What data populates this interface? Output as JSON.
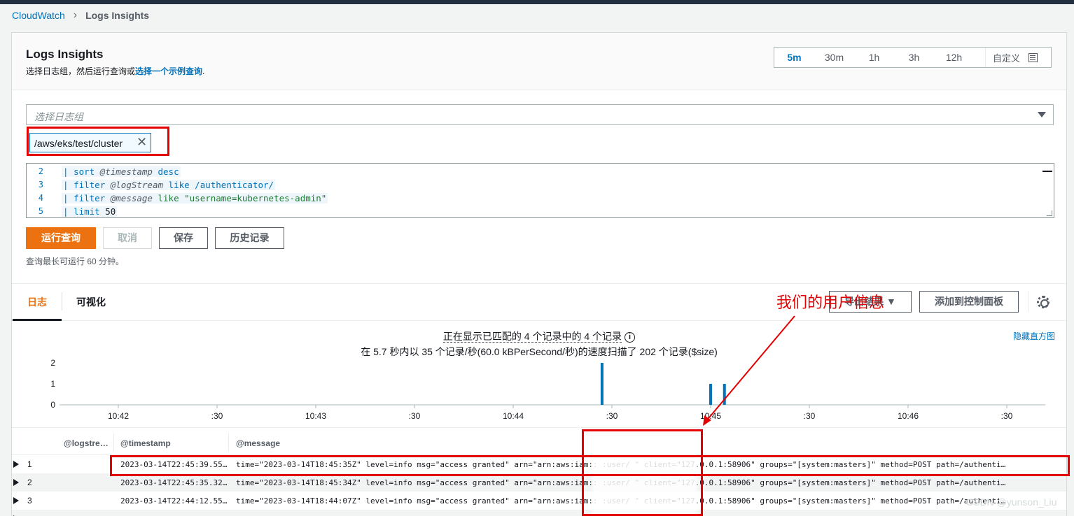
{
  "breadcrumb": {
    "root": "CloudWatch",
    "current": "Logs Insights"
  },
  "header": {
    "title": "Logs Insights",
    "subtitle_prefix": "选择日志组，然后运行查询或",
    "subtitle_link": "选择一个示例查询",
    "subtitle_suffix": "."
  },
  "time_range": {
    "options": [
      "5m",
      "30m",
      "1h",
      "3h",
      "12h"
    ],
    "selected": "5m",
    "custom_label": "自定义"
  },
  "log_group_select": {
    "placeholder": "选择日志组",
    "selected_token": "/aws/eks/test/cluster"
  },
  "query": {
    "lines": [
      {
        "n": "2",
        "kw": "sort",
        "field": "@timestamp",
        "rest": "desc"
      },
      {
        "n": "3",
        "kw": "filter",
        "field": "@logStream",
        "rest": "like /authenticator/"
      },
      {
        "n": "4",
        "kw": "filter",
        "field": "@message",
        "rest": "like \"username=kubernetes-admin\""
      },
      {
        "n": "5",
        "kw": "limit",
        "field": "",
        "rest": "50"
      }
    ]
  },
  "actions": {
    "run": "运行查询",
    "cancel": "取消",
    "save": "保存",
    "history": "历史记录"
  },
  "note": "查询最长可运行 60 分钟。",
  "tabs": {
    "logs": "日志",
    "visualization": "可视化",
    "export": "导出结果",
    "add_dashboard": "添加到控制面板"
  },
  "stats": {
    "line1": "正在显示已匹配的 4 个记录中的 4 个记录",
    "line2": "在 5.7 秒内以 35 个记录/秒(60.0 kBPerSecond/秒)的速度扫描了 202 个记录($size)",
    "hide_histogram": "隐藏直方图"
  },
  "chart_data": {
    "type": "bar",
    "y_ticks": [
      "2",
      "1",
      "0"
    ],
    "ylim": [
      0,
      2
    ],
    "x_ticks": [
      "10:42",
      ":30",
      "10:43",
      ":30",
      "10:44",
      ":30",
      "10:45",
      ":30",
      "10:46",
      ":30"
    ],
    "bars": [
      {
        "x_position_minutes": 2.45,
        "value": 2
      },
      {
        "x_position_minutes": 3.0,
        "value": 1
      },
      {
        "x_position_minutes": 3.07,
        "value": 1
      }
    ],
    "color": "#0073bb"
  },
  "table": {
    "columns": [
      "@logstre…",
      "@timestamp",
      "@message"
    ],
    "rows": [
      {
        "n": "1",
        "ts": "2023-03-14T22:45:39.55…",
        "msg": "time=\"2023-03-14T18:45:35Z\" level=info msg=\"access granted\" arn=\"arn:aws:iam::          :user/     \" client=\"127.0.0.1:58906\" groups=\"[system:masters]\" method=POST path=/authenti…"
      },
      {
        "n": "2",
        "ts": "2023-03-14T22:45:35.32…",
        "msg": "time=\"2023-03-14T18:45:34Z\" level=info msg=\"access granted\" arn=\"arn:aws:iam::          :user/     \" client=\"127.0.0.1:58906\" groups=\"[system:masters]\" method=POST path=/authenti…"
      },
      {
        "n": "3",
        "ts": "2023-03-14T22:44:12.55…",
        "msg": "time=\"2023-03-14T18:44:07Z\" level=info msg=\"access granted\" arn=\"arn:aws:iam::          :user/     \" client=\"127.0.0.1:58906\" groups=\"[system:masters]\" method=POST path=/authenti…"
      }
    ]
  },
  "annotation": "我们的用户信息",
  "watermark": "CSDN @yunson_Liu"
}
